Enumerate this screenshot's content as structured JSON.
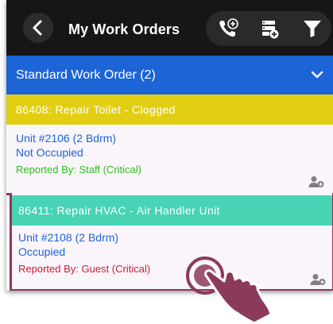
{
  "header": {
    "title": "My Work Orders"
  },
  "group": {
    "label": "Standard Work Order (2)"
  },
  "work_orders": [
    {
      "title": "86408: Repair Toilet - Clogged",
      "unit": "Unit #2106 (2 Bdrm)",
      "occupancy": "Not Occupied",
      "reported": "Reported By: Staff  (Critical)",
      "header_color": "#e2cf13",
      "reported_color": "#2cc11c"
    },
    {
      "title": "86411: Repair HVAC - Air Handler Unit",
      "unit": "Unit #2108 (2 Bdrm)",
      "occupancy": "Occupied",
      "reported": "Reported By: Guest  (Critical)",
      "header_color": "#48d3b5",
      "reported_color": "#c81e35"
    }
  ],
  "icons": {
    "back": "back-chevron-icon",
    "call": "phone-call-icon",
    "add_list": "add-to-list-icon",
    "filter": "filter-icon",
    "assign": "assign-user-icon",
    "expand": "chevron-down-icon"
  },
  "colors": {
    "topbar": "#161616",
    "accent_blue": "#1d64d6",
    "selected_border": "#8c3a5c"
  }
}
